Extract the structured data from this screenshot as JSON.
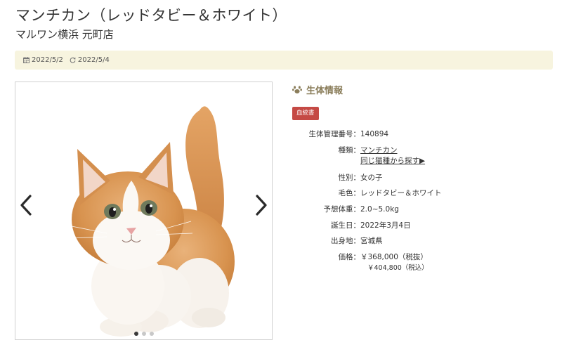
{
  "header": {
    "title": "マンチカン（レッドタビー＆ホワイト）",
    "shop": "マルワン横浜 元町店"
  },
  "dates": {
    "posted": "2022/5/2",
    "updated": "2022/5/4",
    "posted_icon": "calendar-icon",
    "updated_icon": "refresh-icon"
  },
  "gallery": {
    "slide_count": 3,
    "active_slide": 1,
    "prev_icon": "chevron-left-icon",
    "next_icon": "chevron-right-icon"
  },
  "info": {
    "heading": "生体情報",
    "heading_icon": "paw-icon",
    "pedigree_badge": "血統書",
    "badge_color": "#c54a45",
    "rows": {
      "id": {
        "label": "生体管理番号：",
        "value": "140894"
      },
      "breed": {
        "label": "種類：",
        "value": "マンチカン",
        "link": "同じ猫種から探す▶"
      },
      "sex": {
        "label": "性別：",
        "value": "女の子"
      },
      "color": {
        "label": "毛色：",
        "value": "レッドタビー＆ホワイト"
      },
      "weight": {
        "label": "予想体重：",
        "value": "2.0~5.0kg"
      },
      "birthday": {
        "label": "誕生日：",
        "value": "2022年3月4日"
      },
      "origin": {
        "label": "出身地：",
        "value": "宮城県"
      },
      "price": {
        "label": "価格：",
        "value": "￥368,000（税抜）",
        "tax_included": "￥404,800（税込）"
      }
    }
  },
  "colors": {
    "date_bar": "#f7f4df",
    "heading": "#8a7d5a"
  }
}
